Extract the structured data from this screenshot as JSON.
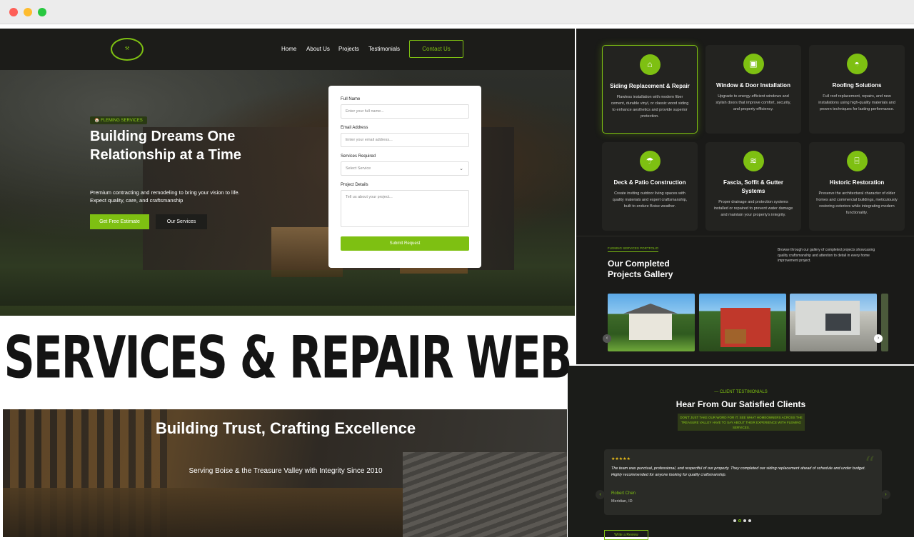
{
  "nav": {
    "logo": "FLEMING SERVICES LLC",
    "links": [
      "Home",
      "About Us",
      "Projects",
      "Testimonials"
    ],
    "contact": "Contact Us"
  },
  "hero": {
    "badge": "FLEMING SERVICES",
    "headline": "Building Dreams One Relationship at a Time",
    "sub": "Premium contracting and remodeling to bring your vision to life. Expect quality, care, and craftsmanship",
    "cta_primary": "Get Free Estimate",
    "cta_secondary": "Our Services"
  },
  "form": {
    "name_label": "Full Name",
    "name_placeholder": "Enter your full name...",
    "email_label": "Email Address",
    "email_placeholder": "Enter your email address...",
    "service_label": "Services Required",
    "service_value": "Select Service",
    "details_label": "Project Details",
    "details_placeholder": "Tell us about your project...",
    "submit": "Submit Request"
  },
  "banner": "SERVICES & REPAIR WEB",
  "trust": {
    "title": "Building Trust, Crafting Excellence",
    "sub": "Serving Boise & the Treasure Valley with Integrity Since 2010"
  },
  "services": [
    {
      "icon": "house-icon",
      "title": "Siding Replacement & Repair",
      "text": "Flawless installation with modern fiber cement, durable vinyl, or classic wood siding to enhance aesthetics and provide superior protection."
    },
    {
      "icon": "window-icon",
      "title": "Window & Door Installation",
      "text": "Upgrade to energy-efficient windows and stylish doors that improve comfort, security, and property efficiency."
    },
    {
      "icon": "helmet-icon",
      "title": "Roofing Solutions",
      "text": "Full roof replacement, repairs, and new installations using high-quality materials and proven techniques for lasting performance."
    },
    {
      "icon": "umbrella-icon",
      "title": "Deck & Patio Construction",
      "text": "Create inviting outdoor living spaces with quality materials and expert craftsmanship, built to endure Boise weather."
    },
    {
      "icon": "water-icon",
      "title": "Fascia, Soffit & Gutter Systems",
      "text": "Proper drainage and protection systems installed or repaired to prevent water damage and maintain your property's integrity."
    },
    {
      "icon": "landmark-icon",
      "title": "Historic Restoration",
      "text": "Preserve the architectural character of older homes and commercial buildings, meticulously restoring exteriors while integrating modern functionality."
    }
  ],
  "portfolio": {
    "tag": "FLEMING SERVICES PORTFOLIO",
    "title": "Our Completed Projects Gallery",
    "desc": "Browse through our gallery of completed projects showcasing quality craftsmanship and attention to detail in every home improvement project."
  },
  "testimonials": {
    "tag": "CLIENT TESTIMONIALS",
    "title": "Hear From Our Satisfied Clients",
    "sub": "DON'T JUST TAKE OUR WORD FOR IT. SEE WHAT HOMEOWNERS ACROSS THE TREASURE VALLEY HAVE TO SAY ABOUT THEIR EXPERIENCE WITH FLEMING SERVICES.",
    "stars": "★★★★★",
    "review": "The team was punctual, professional, and respectful of our property. They completed our siding replacement ahead of schedule and under budget. Highly recommended for anyone looking for quality craftsmanship.",
    "name": "Robert Chen",
    "location": "Meridian, ID",
    "write_btn": "Write a Review"
  },
  "colors": {
    "accent": "#7ec012",
    "dark": "#1a1a18"
  }
}
